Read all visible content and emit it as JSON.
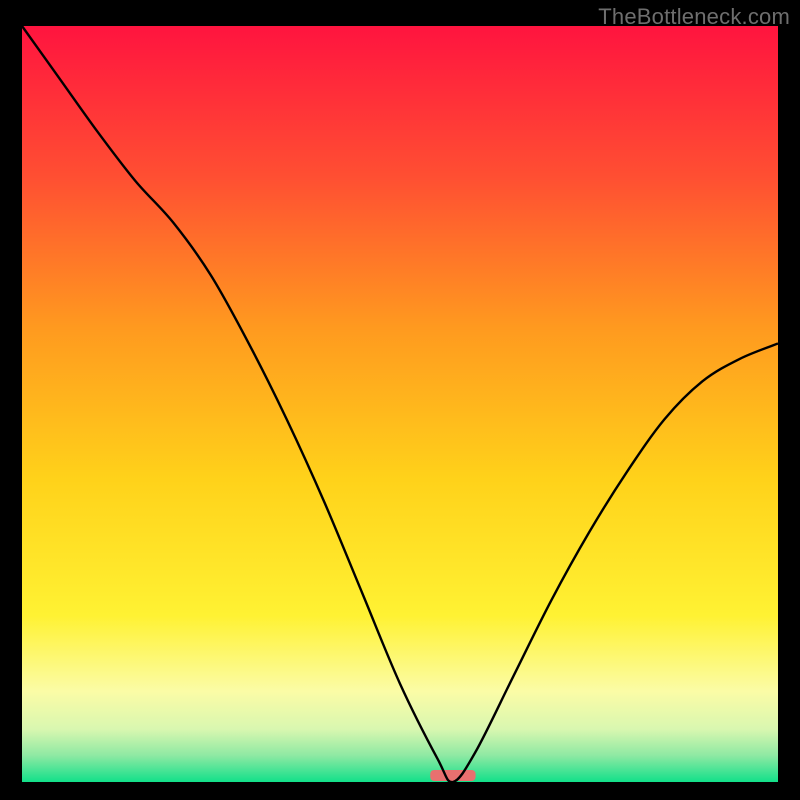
{
  "watermark": "TheBottleneck.com",
  "chart_data": {
    "type": "line",
    "title": "",
    "xlabel": "",
    "ylabel": "",
    "xlim": [
      0,
      100
    ],
    "ylim": [
      0,
      100
    ],
    "x": [
      0,
      5,
      10,
      15,
      20,
      25,
      30,
      35,
      40,
      45,
      50,
      55,
      57,
      60,
      65,
      70,
      75,
      80,
      85,
      90,
      95,
      100
    ],
    "values": [
      100,
      93,
      86,
      79.5,
      74,
      67,
      58,
      48,
      37,
      25,
      13,
      3,
      0,
      4,
      14,
      24,
      33,
      41,
      48,
      53,
      56,
      58
    ],
    "marker": {
      "x": 57,
      "width": 6,
      "color": "#e9706f"
    },
    "background_gradient": {
      "stops": [
        {
          "offset": 0,
          "color": "#ff143f"
        },
        {
          "offset": 0.2,
          "color": "#ff4f32"
        },
        {
          "offset": 0.4,
          "color": "#ff9a1f"
        },
        {
          "offset": 0.6,
          "color": "#ffd21a"
        },
        {
          "offset": 0.78,
          "color": "#fff233"
        },
        {
          "offset": 0.88,
          "color": "#fbfca6"
        },
        {
          "offset": 0.93,
          "color": "#d9f7b0"
        },
        {
          "offset": 0.965,
          "color": "#8ee9a3"
        },
        {
          "offset": 1.0,
          "color": "#12e08a"
        }
      ]
    }
  }
}
